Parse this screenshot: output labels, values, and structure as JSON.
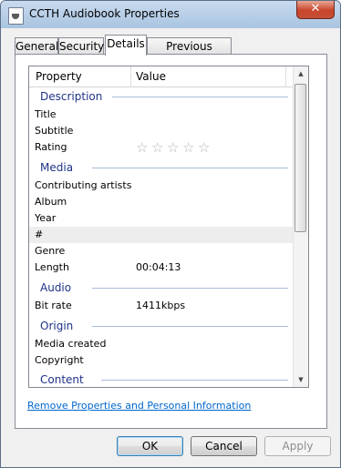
{
  "window": {
    "title": "CCTH Audiobook Properties",
    "close_glyph": "✕"
  },
  "tabs": [
    {
      "label": "General"
    },
    {
      "label": "Security"
    },
    {
      "label": "Details"
    },
    {
      "label": "Previous Versions"
    }
  ],
  "active_tab": "Details",
  "list": {
    "columns": {
      "property": "Property",
      "value": "Value"
    },
    "groups": {
      "description": "Description",
      "media": "Media",
      "audio": "Audio",
      "origin": "Origin",
      "content": "Content"
    },
    "rows": {
      "title": {
        "property": "Title",
        "value": ""
      },
      "subtitle": {
        "property": "Subtitle",
        "value": ""
      },
      "rating": {
        "property": "Rating",
        "stars": 0,
        "max_stars": 5
      },
      "contributing_artists": {
        "property": "Contributing artists",
        "value": ""
      },
      "album": {
        "property": "Album",
        "value": ""
      },
      "year": {
        "property": "Year",
        "value": ""
      },
      "track_number": {
        "property": "#",
        "value": ""
      },
      "genre": {
        "property": "Genre",
        "value": ""
      },
      "length": {
        "property": "Length",
        "value": "00:04:13"
      },
      "bit_rate": {
        "property": "Bit rate",
        "value": "1411kbps"
      },
      "media_created": {
        "property": "Media created",
        "value": ""
      },
      "copyright": {
        "property": "Copyright",
        "value": ""
      }
    },
    "selected_row": "track_number",
    "star_glyph": "☆"
  },
  "scrollbar": {
    "up_glyph": "▲",
    "down_glyph": "▼",
    "position": 0
  },
  "remove_link": "Remove Properties and Personal Information",
  "buttons": {
    "ok": "OK",
    "cancel": "Cancel",
    "apply": "Apply"
  },
  "colors": {
    "group_heading": "#1e3287",
    "link": "#0066cc",
    "selected_row": "#ededed"
  }
}
